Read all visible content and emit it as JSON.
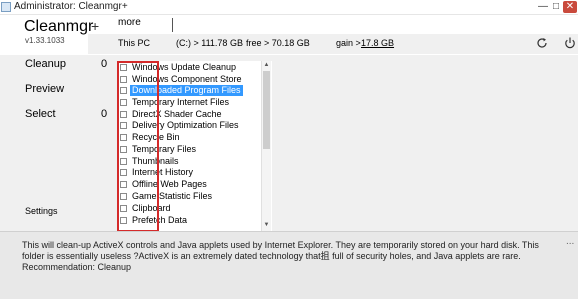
{
  "window": {
    "title": "Administrator: Cleanmgr+",
    "minimize": "—",
    "maximize": "□",
    "close": "✕"
  },
  "header": {
    "app_name": "Cleanmgr",
    "version": "v1.33.1033",
    "add_tab": "+",
    "more_tab": "more"
  },
  "infobar": {
    "location": "This PC",
    "drive": "(C:) > 111.78 GB",
    "free": "free > 70.18 GB",
    "gain_label": "gain >",
    "gain_value": "17.8 GB"
  },
  "sidebar": {
    "cleanup_label": "Cleanup",
    "cleanup_count": "0",
    "preview_label": "Preview",
    "select_label": "Select",
    "select_count": "0",
    "settings_label": "Settings"
  },
  "list": {
    "items": [
      {
        "label": "Windows Update Cleanup",
        "checked": false
      },
      {
        "label": "Windows Component Store",
        "checked": false
      },
      {
        "label": "Downloaded Program Files",
        "checked": false,
        "selected": true
      },
      {
        "label": "Temporary Internet Files",
        "checked": false
      },
      {
        "label": "DirectX Shader Cache",
        "checked": false
      },
      {
        "label": "Delivery Optimization Files",
        "checked": false
      },
      {
        "label": "Recycle Bin",
        "checked": false
      },
      {
        "label": "Temporary Files",
        "checked": false
      },
      {
        "label": "Thumbnails",
        "checked": false
      },
      {
        "label": "Internet History",
        "checked": false
      },
      {
        "label": "Offline Web Pages",
        "checked": false
      },
      {
        "label": "Game Statistic Files",
        "checked": false
      },
      {
        "label": "Clipboard",
        "checked": false
      },
      {
        "label": "Prefetch Data",
        "checked": false
      }
    ]
  },
  "description": {
    "text": "This will clean-up ActiveX controls and Java applets used by Internet Explorer. They are temporarily stored on your hard disk. This folder is essentially useless ?ActiveX is an extremely dated technology that抯 full of security holes, and Java applets are rare. Recommendation: Cleanup",
    "more": "..."
  },
  "colors": {
    "selection": "#3399ff",
    "highlight_box": "#d42a2a",
    "panel": "#f0f0f0"
  },
  "icons": [
    "app-icon",
    "refresh-icon",
    "power-icon"
  ]
}
